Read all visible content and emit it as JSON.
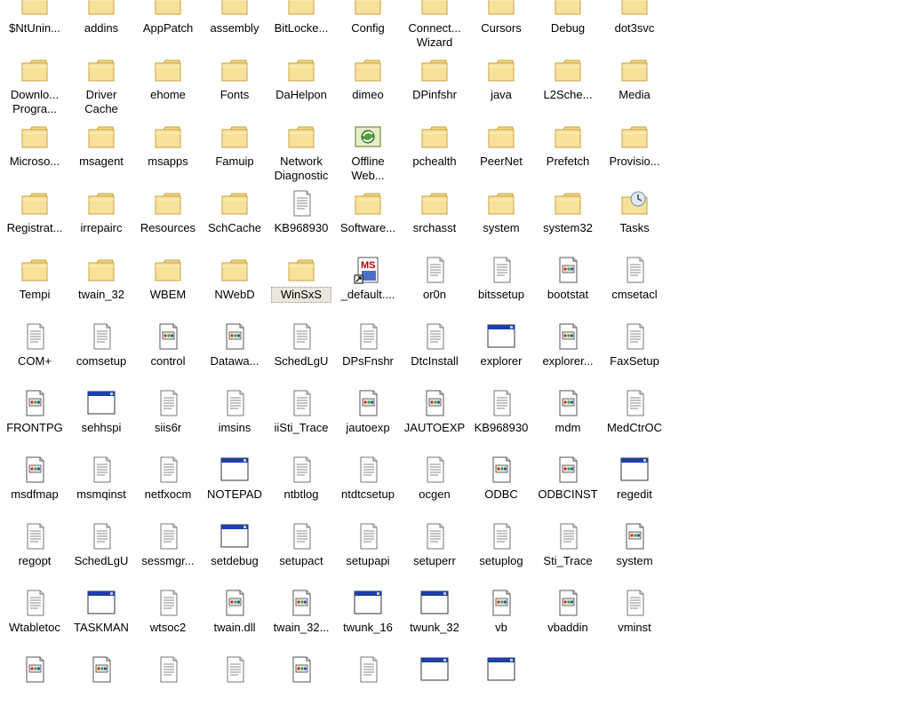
{
  "folder": {
    "items": [
      {
        "label": "$NtUnin...",
        "icon": "folder-icon"
      },
      {
        "label": "addins",
        "icon": "folder-icon"
      },
      {
        "label": "AppPatch",
        "icon": "folder-icon"
      },
      {
        "label": "assembly",
        "icon": "folder-icon"
      },
      {
        "label": "BitLocke...",
        "icon": "folder-icon"
      },
      {
        "label": "Config",
        "icon": "folder-icon"
      },
      {
        "label": "Connect...\nWizard",
        "icon": "folder-icon"
      },
      {
        "label": "Cursors",
        "icon": "folder-icon"
      },
      {
        "label": "Debug",
        "icon": "folder-icon"
      },
      {
        "label": "dot3svc",
        "icon": "folder-icon"
      },
      {
        "label": "Downlo...\nProgra...",
        "icon": "folder-icon"
      },
      {
        "label": "Driver\nCache",
        "icon": "folder-icon"
      },
      {
        "label": "ehome",
        "icon": "folder-icon"
      },
      {
        "label": "Fonts",
        "icon": "folder-icon"
      },
      {
        "label": "DaHelpon",
        "icon": "folder-icon"
      },
      {
        "label": "dimeo",
        "icon": "folder-icon"
      },
      {
        "label": "DPinfshr",
        "icon": "folder-icon"
      },
      {
        "label": "java",
        "icon": "folder-icon"
      },
      {
        "label": "L2Sche...",
        "icon": "folder-icon"
      },
      {
        "label": "Media",
        "icon": "folder-icon"
      },
      {
        "label": "Microso...",
        "icon": "folder-icon"
      },
      {
        "label": "msagent",
        "icon": "folder-icon"
      },
      {
        "label": "msapps",
        "icon": "folder-icon"
      },
      {
        "label": "Famuip",
        "icon": "folder-icon"
      },
      {
        "label": "Network\nDiagnostic",
        "icon": "folder-icon"
      },
      {
        "label": "Offline\nWeb...",
        "icon": "offline-web-folder-icon"
      },
      {
        "label": "pchealth",
        "icon": "folder-icon"
      },
      {
        "label": "PeerNet",
        "icon": "folder-icon"
      },
      {
        "label": "Prefetch",
        "icon": "folder-icon"
      },
      {
        "label": "Provisio...",
        "icon": "folder-icon"
      },
      {
        "label": "Registrat...",
        "icon": "folder-icon"
      },
      {
        "label": "irrepairc",
        "icon": "folder-icon"
      },
      {
        "label": "Resources",
        "icon": "folder-icon"
      },
      {
        "label": "SchCache",
        "icon": "folder-icon"
      },
      {
        "label": "KB968930",
        "icon": "text-file-icon"
      },
      {
        "label": "Software...",
        "icon": "folder-icon"
      },
      {
        "label": "srchasst",
        "icon": "folder-icon"
      },
      {
        "label": "system",
        "icon": "folder-icon"
      },
      {
        "label": "system32",
        "icon": "folder-icon"
      },
      {
        "label": "Tasks",
        "icon": "tasks-folder-icon"
      },
      {
        "label": "Tempi",
        "icon": "folder-icon"
      },
      {
        "label": "twain_32",
        "icon": "folder-icon"
      },
      {
        "label": "WBEM",
        "icon": "folder-icon"
      },
      {
        "label": "NWebD",
        "icon": "folder-icon"
      },
      {
        "label": "WinSxS",
        "icon": "folder-icon",
        "selected": true
      },
      {
        "label": "_default....",
        "icon": "ms-setup-icon"
      },
      {
        "label": "or0n",
        "icon": "text-file-icon"
      },
      {
        "label": "bitssetup",
        "icon": "text-file-icon"
      },
      {
        "label": "bootstat",
        "icon": "settings-file-icon"
      },
      {
        "label": "cmsetacl",
        "icon": "text-file-icon"
      },
      {
        "label": "COM+",
        "icon": "text-file-icon"
      },
      {
        "label": "comsetup",
        "icon": "text-file-icon"
      },
      {
        "label": "control",
        "icon": "settings-file-icon"
      },
      {
        "label": "Datawa...",
        "icon": "settings-file-icon"
      },
      {
        "label": "SchedLgU",
        "icon": "text-file-icon"
      },
      {
        "label": "DPsFnshr",
        "icon": "text-file-icon"
      },
      {
        "label": "DtcInstall",
        "icon": "text-file-icon"
      },
      {
        "label": "explorer",
        "icon": "application-icon"
      },
      {
        "label": "explorer...",
        "icon": "settings-file-icon"
      },
      {
        "label": "FaxSetup",
        "icon": "text-file-icon"
      },
      {
        "label": "FRONTPG",
        "icon": "settings-file-icon"
      },
      {
        "label": "sehhspi",
        "icon": "application-icon"
      },
      {
        "label": "siis6r",
        "icon": "text-file-icon"
      },
      {
        "label": "imsins",
        "icon": "text-file-icon"
      },
      {
        "label": "iiSti_Trace",
        "icon": "text-file-icon"
      },
      {
        "label": "jautoexp",
        "icon": "settings-file-icon"
      },
      {
        "label": "JAUTOEXP",
        "icon": "settings-file-icon"
      },
      {
        "label": "KB968930",
        "icon": "text-file-icon"
      },
      {
        "label": "mdm",
        "icon": "settings-file-icon"
      },
      {
        "label": "MedCtrOC",
        "icon": "text-file-icon"
      },
      {
        "label": "msdfmap",
        "icon": "settings-file-icon"
      },
      {
        "label": "msmqinst",
        "icon": "text-file-icon"
      },
      {
        "label": "netfxocm",
        "icon": "text-file-icon"
      },
      {
        "label": "NOTEPAD",
        "icon": "application-icon"
      },
      {
        "label": "ntbtlog",
        "icon": "text-file-icon"
      },
      {
        "label": "ntdtcsetup",
        "icon": "text-file-icon"
      },
      {
        "label": "ocgen",
        "icon": "text-file-icon"
      },
      {
        "label": "ODBC",
        "icon": "settings-file-icon"
      },
      {
        "label": "ODBCINST",
        "icon": "settings-file-icon"
      },
      {
        "label": "regedit",
        "icon": "application-icon"
      },
      {
        "label": "regopt",
        "icon": "text-file-icon"
      },
      {
        "label": "SchedLgU",
        "icon": "text-file-icon"
      },
      {
        "label": "sessmgr...",
        "icon": "text-file-icon"
      },
      {
        "label": "setdebug",
        "icon": "application-icon"
      },
      {
        "label": "setupact",
        "icon": "text-file-icon"
      },
      {
        "label": "setupapi",
        "icon": "text-file-icon"
      },
      {
        "label": "setuperr",
        "icon": "text-file-icon"
      },
      {
        "label": "setuplog",
        "icon": "text-file-icon"
      },
      {
        "label": "Sti_Trace",
        "icon": "text-file-icon"
      },
      {
        "label": "system",
        "icon": "settings-file-icon"
      },
      {
        "label": "Wtabletoc",
        "icon": "text-file-icon"
      },
      {
        "label": "TASKMAN",
        "icon": "application-icon"
      },
      {
        "label": "wtsoc2",
        "icon": "text-file-icon"
      },
      {
        "label": "twain.dll",
        "icon": "settings-file-icon"
      },
      {
        "label": "twain_32...",
        "icon": "settings-file-icon"
      },
      {
        "label": "twunk_16",
        "icon": "application-icon"
      },
      {
        "label": "twunk_32",
        "icon": "application-icon"
      },
      {
        "label": "vb",
        "icon": "settings-file-icon"
      },
      {
        "label": "vbaddin",
        "icon": "settings-file-icon"
      },
      {
        "label": "vminst",
        "icon": "text-file-icon"
      },
      {
        "label": "",
        "icon": "settings-file-icon"
      },
      {
        "label": "",
        "icon": "settings-file-icon"
      },
      {
        "label": "",
        "icon": "text-file-icon"
      },
      {
        "label": "",
        "icon": "text-file-icon"
      },
      {
        "label": "",
        "icon": "settings-file-icon"
      },
      {
        "label": "",
        "icon": "text-file-icon"
      },
      {
        "label": "",
        "icon": "application-icon"
      },
      {
        "label": "",
        "icon": "application-icon"
      }
    ]
  }
}
